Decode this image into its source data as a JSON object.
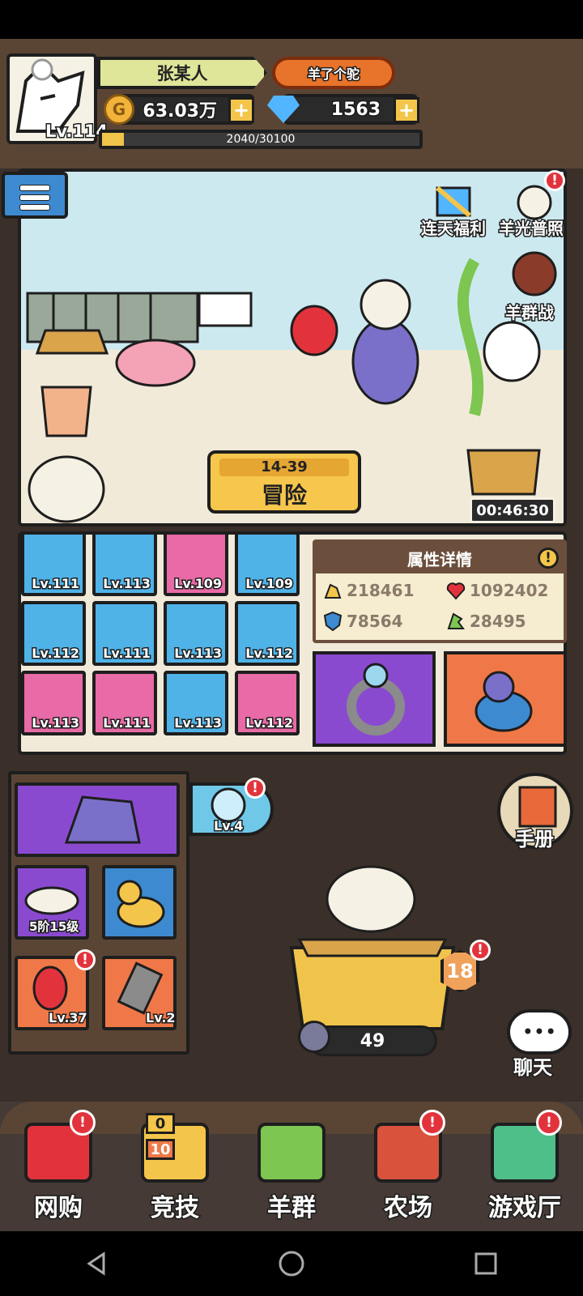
{
  "player": {
    "name": "张某人",
    "level_label": "Lv.114",
    "title": "羊了个驼"
  },
  "currency": {
    "gold": "63.03万",
    "gold_icon_letter": "G",
    "gems": "1563"
  },
  "xp": {
    "text": "2040/30100",
    "current": 2040,
    "max": 30100
  },
  "scene": {
    "events": [
      "连天福利",
      "羊光普照",
      "羊群战"
    ],
    "adventure": {
      "stage": "14-39",
      "label": "冒险"
    },
    "chest_timer": "00:46:30"
  },
  "equipment": [
    {
      "level": "Lv.111",
      "color": "#4fb3e8"
    },
    {
      "level": "Lv.113",
      "color": "#4fb3e8"
    },
    {
      "level": "Lv.109",
      "color": "#e86aa6"
    },
    {
      "level": "Lv.109",
      "color": "#4fb3e8"
    },
    {
      "level": "Lv.112",
      "color": "#4fb3e8"
    },
    {
      "level": "Lv.111",
      "color": "#4fb3e8"
    },
    {
      "level": "Lv.113",
      "color": "#4fb3e8"
    },
    {
      "level": "Lv.112",
      "color": "#4fb3e8"
    },
    {
      "level": "Lv.113",
      "color": "#e86aa6"
    },
    {
      "level": "Lv.111",
      "color": "#e86aa6"
    },
    {
      "level": "Lv.113",
      "color": "#4fb3e8"
    },
    {
      "level": "Lv.112",
      "color": "#e86aa6"
    }
  ],
  "attributes": {
    "title": "属性详情",
    "attack": "218461",
    "hp": "1092402",
    "defense": "78564",
    "speed": "28495"
  },
  "left_panel": {
    "cloud_label": "5阶15级",
    "parrot_level": "Lv.37",
    "clipper_level": "Lv.2",
    "fishbowl_level": "Lv.4"
  },
  "handbook_label": "手册",
  "chat_label": "聊天",
  "alert_mark": "!",
  "plus_mark": "+",
  "nest": {
    "badge": "18",
    "count": "49"
  },
  "nav": [
    {
      "label": "网购",
      "color": "#e2333d"
    },
    {
      "label": "竞技",
      "color": "#f3c54a"
    },
    {
      "label": "羊群",
      "color": "#7cc651"
    },
    {
      "label": "农场",
      "color": "#d9523b"
    },
    {
      "label": "游戏厅",
      "color": "#4fbf8a"
    }
  ],
  "arena_counts": {
    "top": "0",
    "bottom": "10"
  }
}
